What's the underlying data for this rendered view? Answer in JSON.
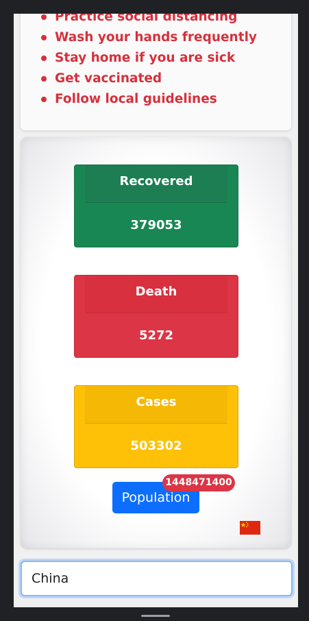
{
  "tips": {
    "items": [
      "Practice social distancing",
      "Wash your hands frequently",
      "Stay home if you are sick",
      "Get vaccinated",
      "Follow local guidelines"
    ]
  },
  "stats": {
    "recovered": {
      "label": "Recovered",
      "value": "379053"
    },
    "death": {
      "label": "Death",
      "value": "5272"
    },
    "cases": {
      "label": "Cases",
      "value": "503302"
    }
  },
  "population": {
    "button_label": "Population",
    "badge": "1448471400"
  },
  "flag": {
    "icon": "china-flag-icon"
  },
  "search": {
    "value": "China"
  },
  "colors": {
    "recovered": "#198754",
    "death": "#dc3545",
    "cases": "#ffc107",
    "primary": "#0d6efd",
    "tip_text": "#d6303c"
  }
}
